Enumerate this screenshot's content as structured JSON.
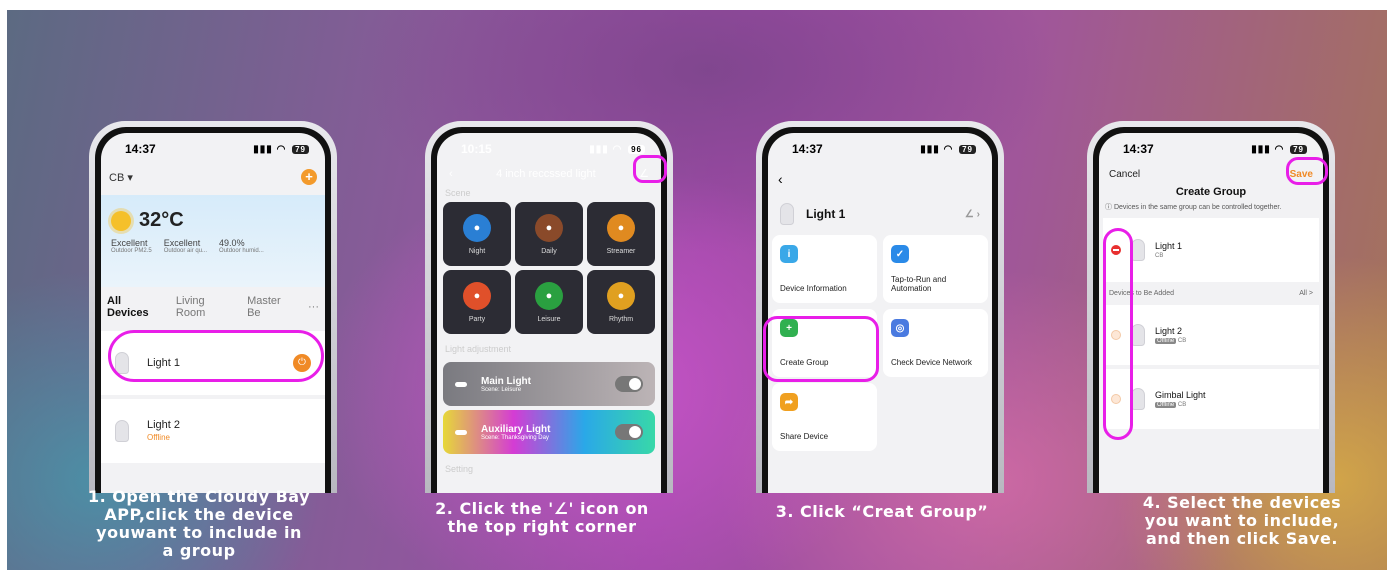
{
  "colors": {
    "highlight": "#e81ee8",
    "accent": "#f08a26"
  },
  "step1": {
    "time": "14:37",
    "battery": "79",
    "home": "CB",
    "temperature": "32°C",
    "weather": [
      {
        "value": "Excellent",
        "label": "Outdoor PM2.5"
      },
      {
        "value": "Excellent",
        "label": "Outdoor air qu..."
      },
      {
        "value": "49.0%",
        "label": "Outdoor humid..."
      }
    ],
    "tabs": [
      "All Devices",
      "Living Room",
      "Master Be"
    ],
    "devices": [
      {
        "name": "Light 1",
        "status": ""
      },
      {
        "name": "Light 2",
        "status": "Offline"
      }
    ],
    "caption": [
      "1. Open the Cloudy Bay",
      "APP,click the device",
      "youwant to include in",
      "a group"
    ]
  },
  "step2": {
    "time": "10:15",
    "battery": "96",
    "title": "4 inch reccssed light",
    "scene_label": "Scene",
    "scenes": [
      {
        "name": "Night",
        "icon": "bed-icon",
        "color": "#2a7fd4"
      },
      {
        "name": "Daily",
        "icon": "cup-icon",
        "color": "#8a4a2a"
      },
      {
        "name": "Streamer",
        "icon": "star-icon",
        "color": "#e08a20"
      },
      {
        "name": "Party",
        "icon": "mic-icon",
        "color": "#e0502a"
      },
      {
        "name": "Leisure",
        "icon": "car-icon",
        "color": "#2aa040"
      },
      {
        "name": "Rhythm",
        "icon": "music-icon",
        "color": "#e0a020"
      }
    ],
    "adjust_label": "Light adjustment",
    "lights": [
      {
        "name": "Main Light",
        "scene": "Scene: Leisure"
      },
      {
        "name": "Auxiliary Light",
        "scene": "Scene: Thanksgiving Day"
      }
    ],
    "setting_label": "Setting",
    "caption": [
      "2. Click the  '∠' icon on",
      "the top right corner"
    ]
  },
  "step3": {
    "time": "14:37",
    "battery": "79",
    "device_name": "Light 1",
    "options": [
      {
        "label": "Device Information",
        "icon": "info-icon",
        "color": "#3aa8e8",
        "glyph": "i"
      },
      {
        "label": "Tap-to-Run and Automation",
        "icon": "check-shield-icon",
        "color": "#2a8ae8",
        "glyph": "✓"
      },
      {
        "label": "Create Group",
        "icon": "group-add-icon",
        "color": "#30b050",
        "glyph": "+"
      },
      {
        "label": "Check Device Network",
        "icon": "network-icon",
        "color": "#4a7ae0",
        "glyph": "◎"
      },
      {
        "label": "Share Device",
        "icon": "share-icon",
        "color": "#f0a020",
        "glyph": "➦"
      }
    ],
    "caption": [
      "3. Click “Creat Group”"
    ]
  },
  "step4": {
    "time": "14:37",
    "battery": "79",
    "cancel": "Cancel",
    "save": "Save",
    "title": "Create Group",
    "note": "Devices in the same group can be controlled together.",
    "selected": {
      "name": "Light 1",
      "home": "CB"
    },
    "to_add_label": "Devices to Be Added",
    "all_label": "All >",
    "candidates": [
      {
        "name": "Light 2",
        "tag": "Offline",
        "home": "CB"
      },
      {
        "name": "Gimbal Light",
        "tag": "Offline",
        "home": "CB"
      }
    ],
    "caption": [
      "4. Select the devices",
      "you want to include,",
      "and then click Save."
    ]
  }
}
